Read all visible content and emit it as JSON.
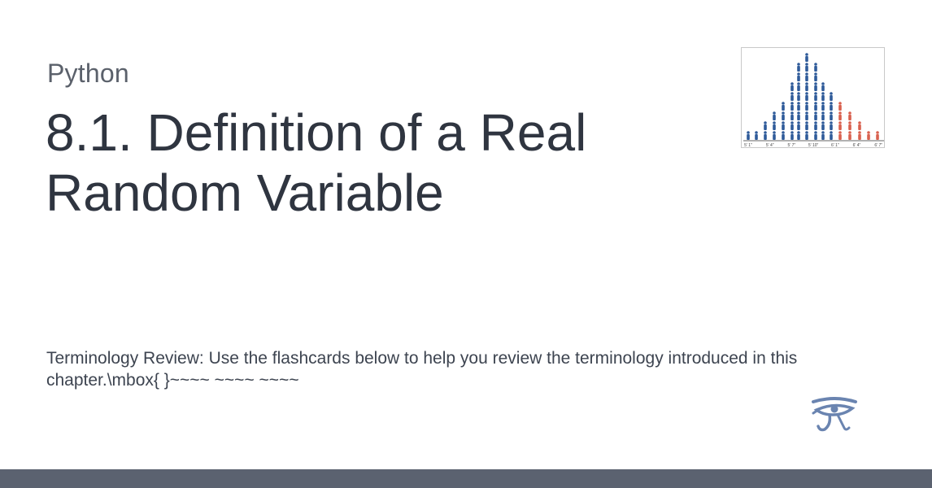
{
  "site": {
    "name": "Python"
  },
  "page": {
    "title": "8.1. Definition of a Real Random Variable",
    "description": "Terminology Review: Use the flashcards below to help you review the terminology introduced in this chapter.\\mbox{ }~~~~ ~~~~ ~~~~"
  },
  "logo": {
    "axis_ticks": [
      "5' 1\"",
      "5' 4\"",
      "5' 7\"",
      "5' 10\"",
      "6' 1\"",
      "6' 4\"",
      "6' 7\""
    ],
    "colors": {
      "blue": "#2f5b9a",
      "red": "#d9614f"
    }
  },
  "icons": {
    "corner": "eye-of-horus-icon"
  },
  "colors": {
    "footer": "#5b6270",
    "text": "#2f3540"
  }
}
